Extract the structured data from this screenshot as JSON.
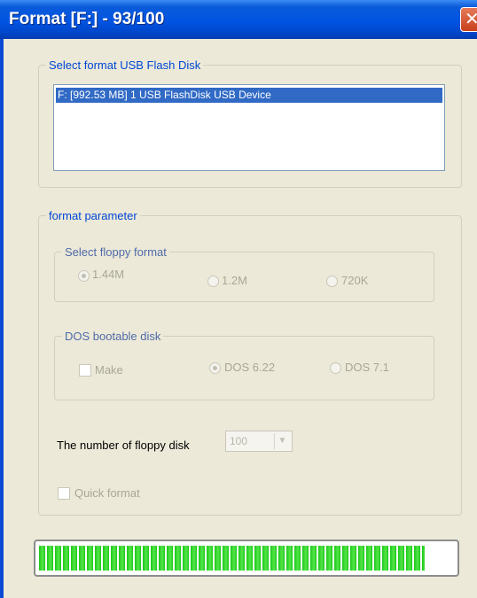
{
  "window": {
    "title": "Format [F:] - 93/100",
    "close_glyph": "✕"
  },
  "disk_section": {
    "legend": "Select format USB Flash Disk",
    "devices": [
      "F: [992.53 MB] 1 USB FlashDisk USB Device"
    ],
    "selected_index": 0
  },
  "params": {
    "legend": "format parameter",
    "floppy": {
      "legend": "Select floppy format",
      "options": [
        "1.44M",
        "1.2M",
        "720K"
      ],
      "selected": "1.44M"
    },
    "dos": {
      "legend": "DOS bootable disk",
      "make_label": "Make",
      "make_checked": false,
      "options": [
        "DOS 6.22",
        "DOS 7.1"
      ],
      "selected": "DOS 6.22"
    },
    "floppy_count": {
      "label": "The number of floppy disk",
      "value": "100"
    },
    "quick_format": {
      "label": "Quick format",
      "checked": false
    }
  },
  "progress": {
    "fraction": 0.93
  },
  "colors": {
    "title_bar": "#0054e3",
    "progress_green": "#1ac918",
    "selection": "#316ac5"
  },
  "icons": {
    "close": "close-icon",
    "dropdown": "chevron-down-icon"
  }
}
